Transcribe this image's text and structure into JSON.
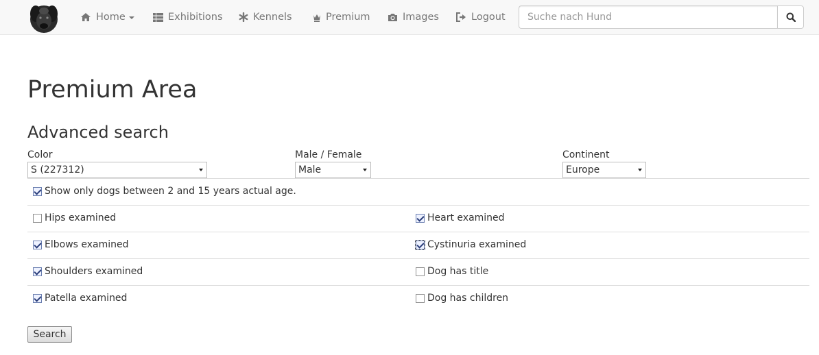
{
  "nav": {
    "items": [
      {
        "label": "Home",
        "icon": "home-icon",
        "has_caret": true
      },
      {
        "label": "Exhibitions",
        "icon": "th-list-icon"
      },
      {
        "label": "Kennels",
        "icon": "asterisk-icon"
      },
      {
        "label": "Premium",
        "icon": "crown-icon"
      },
      {
        "label": "Images",
        "icon": "camera-icon"
      },
      {
        "label": "Logout",
        "icon": "logout-icon"
      }
    ],
    "search_placeholder": "Suche nach Hund",
    "search_value": ""
  },
  "page": {
    "title": "Premium Area",
    "section_title": "Advanced search"
  },
  "filters": {
    "color": {
      "label": "Color",
      "value": "S (227312)"
    },
    "sex": {
      "label": "Male / Female",
      "value": "Male"
    },
    "continent": {
      "label": "Continent",
      "value": "Europe"
    }
  },
  "age_filter": {
    "label": "Show only dogs between 2 and 15 years actual age.",
    "checked": true
  },
  "checkboxes": [
    {
      "label": "Hips examined",
      "checked": false
    },
    {
      "label": "Heart examined",
      "checked": true
    },
    {
      "label": "Elbows examined",
      "checked": true
    },
    {
      "label": "Cystinuria examined",
      "checked": true,
      "focused": true
    },
    {
      "label": "Shoulders examined",
      "checked": true
    },
    {
      "label": "Dog has title",
      "checked": false
    },
    {
      "label": "Patella examined",
      "checked": true
    },
    {
      "label": "Dog has children",
      "checked": false
    }
  ],
  "submit_label": "Search",
  "colors": {
    "navbar_bg": "#f8f8f8",
    "nav_text": "#777777",
    "text": "#333333",
    "divider": "#dddddd"
  }
}
